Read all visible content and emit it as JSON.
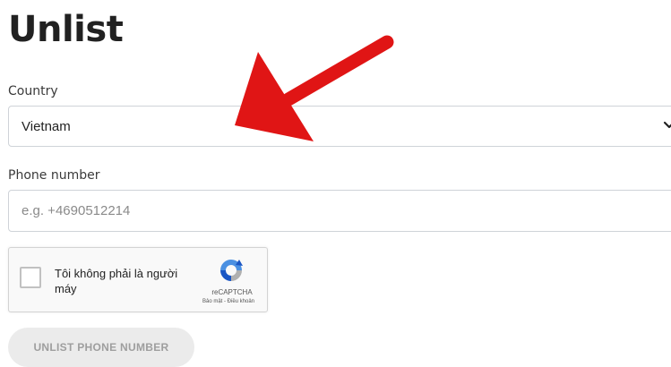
{
  "header": {
    "title": "Unlist"
  },
  "form": {
    "country_label": "Country",
    "country_value": "Vietnam",
    "phone_label": "Phone number",
    "phone_placeholder": "e.g. +4690512214",
    "phone_value": "",
    "submit_label": "UNLIST PHONE NUMBER"
  },
  "captcha": {
    "label": "Tôi không phải là người máy",
    "brand": "reCAPTCHA",
    "terms": "Bảo mật - Điều khoản",
    "checked": false
  },
  "annotation": {
    "arrow_color": "#e01515"
  },
  "colors": {
    "captcha_blue": "#4a90e2",
    "captcha_gray": "#b0b0b0",
    "button_bg": "#ebebeb"
  },
  "icons": {
    "chevron": "chevron-down-icon",
    "recaptcha": "recaptcha-logo-icon"
  }
}
